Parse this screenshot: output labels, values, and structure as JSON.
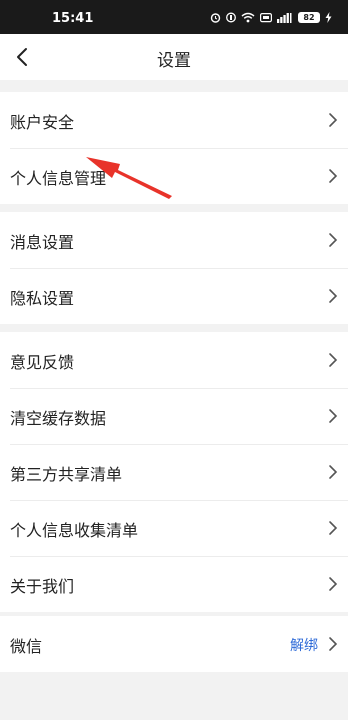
{
  "status_bar": {
    "time": "15:41",
    "battery": "82"
  },
  "nav": {
    "title": "设置"
  },
  "groups": [
    {
      "items": [
        {
          "label": "账户安全"
        },
        {
          "label": "个人信息管理"
        }
      ]
    },
    {
      "items": [
        {
          "label": "消息设置"
        },
        {
          "label": "隐私设置"
        }
      ]
    },
    {
      "items": [
        {
          "label": "意见反馈"
        },
        {
          "label": "清空缓存数据"
        },
        {
          "label": "第三方共享清单"
        },
        {
          "label": "个人信息收集清单"
        },
        {
          "label": "关于我们"
        }
      ]
    },
    {
      "items": [
        {
          "label": "微信",
          "action": "解绑"
        }
      ]
    }
  ],
  "colors": {
    "accent": "#2f6bd8",
    "annotation": "#e8332a",
    "background": "#f2f2f2"
  },
  "icons": {
    "back": "chevron-left-icon",
    "row": "chevron-right-icon"
  }
}
